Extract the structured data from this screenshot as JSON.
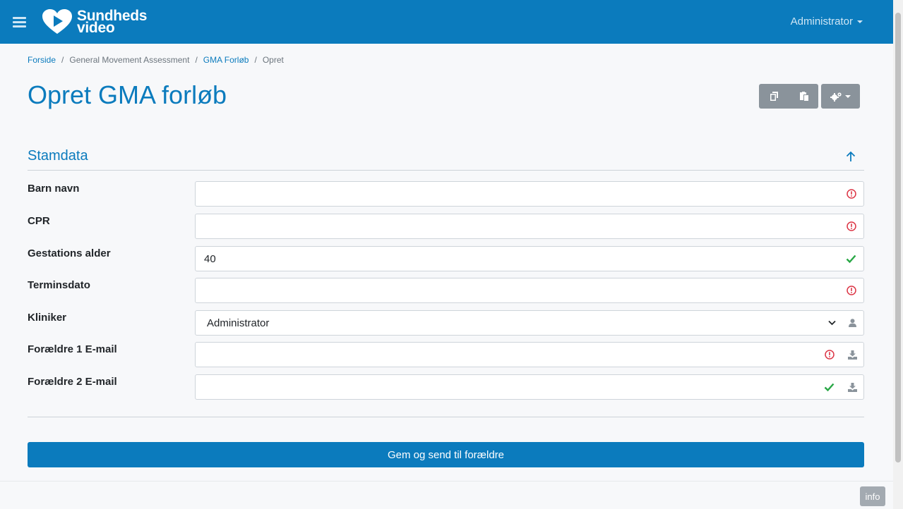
{
  "header": {
    "brand_line1": "Sundheds",
    "brand_line2": "video",
    "user_name": "Administrator"
  },
  "breadcrumb": {
    "items": [
      "Forside",
      "General Movement Assessment",
      "GMA Forløb",
      "Opret"
    ],
    "separator": "/"
  },
  "page": {
    "title": "Opret GMA forløb"
  },
  "section": {
    "title": "Stamdata"
  },
  "form": {
    "fields": [
      {
        "label": "Barn navn",
        "value": "",
        "status": "error"
      },
      {
        "label": "CPR",
        "value": "",
        "status": "error"
      },
      {
        "label": "Gestations alder",
        "value": "40",
        "status": "valid"
      },
      {
        "label": "Terminsdato",
        "value": "",
        "status": "error"
      },
      {
        "label": "Kliniker",
        "value": "Administrator",
        "status": "select"
      },
      {
        "label": "Forældre 1 E-mail",
        "value": "",
        "status": "error"
      },
      {
        "label": "Forældre 2 E-mail",
        "value": "",
        "status": "valid"
      }
    ],
    "submit_label": "Gem og send til forældre"
  },
  "footer": {
    "info_label": "info"
  },
  "colors": {
    "primary": "#0b7bbd",
    "error": "#dc3545",
    "valid": "#28a745",
    "toolbar_gray": "#8a939b"
  },
  "icons": {
    "menu": "hamburger-icon",
    "logo": "heart-play-logo",
    "copy": "copy-icon",
    "paste": "paste-icon",
    "settings": "gears-icon",
    "collapse": "arrow-up-icon",
    "error": "exclamation-circle-icon",
    "valid": "check-icon",
    "user": "user-icon",
    "import": "download-icon"
  }
}
